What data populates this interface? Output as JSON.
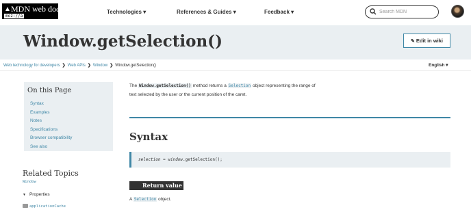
{
  "header": {
    "logo_text": "MDN web docs",
    "logo_sub": "moz://a",
    "nav": [
      {
        "label": "Technologies ▾"
      },
      {
        "label": "References & Guides ▾"
      },
      {
        "label": "Feedback ▾"
      }
    ],
    "search_placeholder": "Search MDN",
    "avatar_icon": "user-avatar"
  },
  "title": {
    "text": "Window.getSelection()",
    "edit_label": "Edit in wiki",
    "edit_icon": "pencil-icon"
  },
  "breadcrumb": {
    "items": [
      "Web technology for developers",
      "Web APIs",
      "Window"
    ],
    "current": "Window.getSelection()",
    "separator": "❯"
  },
  "language": "English ▾",
  "toc": {
    "title": "On this Page",
    "items": [
      "Syntax",
      "Examples",
      "Notes",
      "Specifications",
      "Browser compatibility",
      "See also"
    ]
  },
  "related": {
    "title": "Related Topics",
    "link": "Window",
    "properties_label": "Properties",
    "properties_first": "applicationCache"
  },
  "content": {
    "intro": {
      "p1": "The ",
      "code1": "Window.getSelection()",
      "p2": " method returns a ",
      "code2": "Selection",
      "p3": " object representing the range of",
      "line2": "text selected by the user or the current position of the caret."
    },
    "syntax_heading": "Syntax",
    "syntax": {
      "var": "selection",
      "mid": " = ",
      "obj": "window",
      "tail": ".getSelection();"
    },
    "return_heading": "Return value",
    "return": {
      "a": "A ",
      "code": "Selection",
      "b": " object."
    }
  },
  "colors": {
    "accent": "#3f87a6",
    "band": "#eaeff2",
    "text": "#333333"
  }
}
